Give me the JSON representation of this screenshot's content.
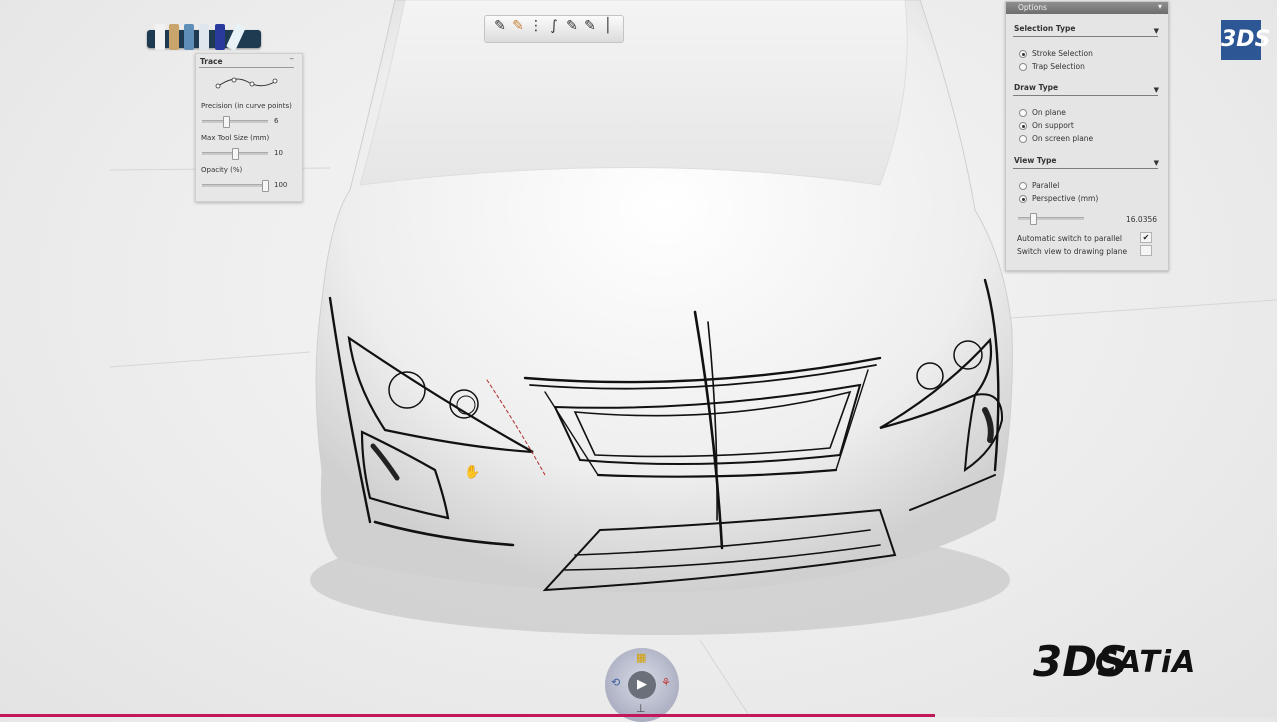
{
  "trace_panel": {
    "title": "Trace",
    "minimize": "–",
    "precision_label": "Precision (in curve points)",
    "precision_value": "6",
    "precision_level": 0.35,
    "tool_size_label": "Max Tool Size (mm)",
    "tool_size_value": "10",
    "tool_size_level": 0.5,
    "opacity_label": "Opacity (%)",
    "opacity_value": "100",
    "opacity_level": 1.0
  },
  "options_panel": {
    "title": "Options",
    "selection_type": {
      "heading": "Selection Type",
      "options": [
        {
          "label": "Stroke Selection",
          "selected": true
        },
        {
          "label": "Trap Selection",
          "selected": false
        }
      ]
    },
    "draw_type": {
      "heading": "Draw Type",
      "options": [
        {
          "label": "On plane",
          "selected": false
        },
        {
          "label": "On support",
          "selected": true
        },
        {
          "label": "On screen plane",
          "selected": false
        }
      ]
    },
    "view_type": {
      "heading": "View Type",
      "options": [
        {
          "label": "Parallel",
          "selected": false
        },
        {
          "label": "Perspective (mm)",
          "selected": true
        }
      ],
      "perspective_value": "16.0356",
      "perspective_level": 0.2
    },
    "auto_switch_label": "Automatic switch to parallel",
    "auto_switch_checked": true,
    "switch_view_label": "Switch view to drawing plane",
    "switch_view_checked": false
  },
  "branding": {
    "badge": "3DS",
    "logo_mark": "3DS",
    "logo_text": "CATiA"
  },
  "icons": {
    "cursor": "hand-cursor-icon",
    "compass_play": "play-icon"
  },
  "colors": {
    "badge_blue": "#2d5694",
    "pen_tray": "#1f3b52",
    "sketch_line": "#111111",
    "accent_bar": "#c2185b"
  }
}
